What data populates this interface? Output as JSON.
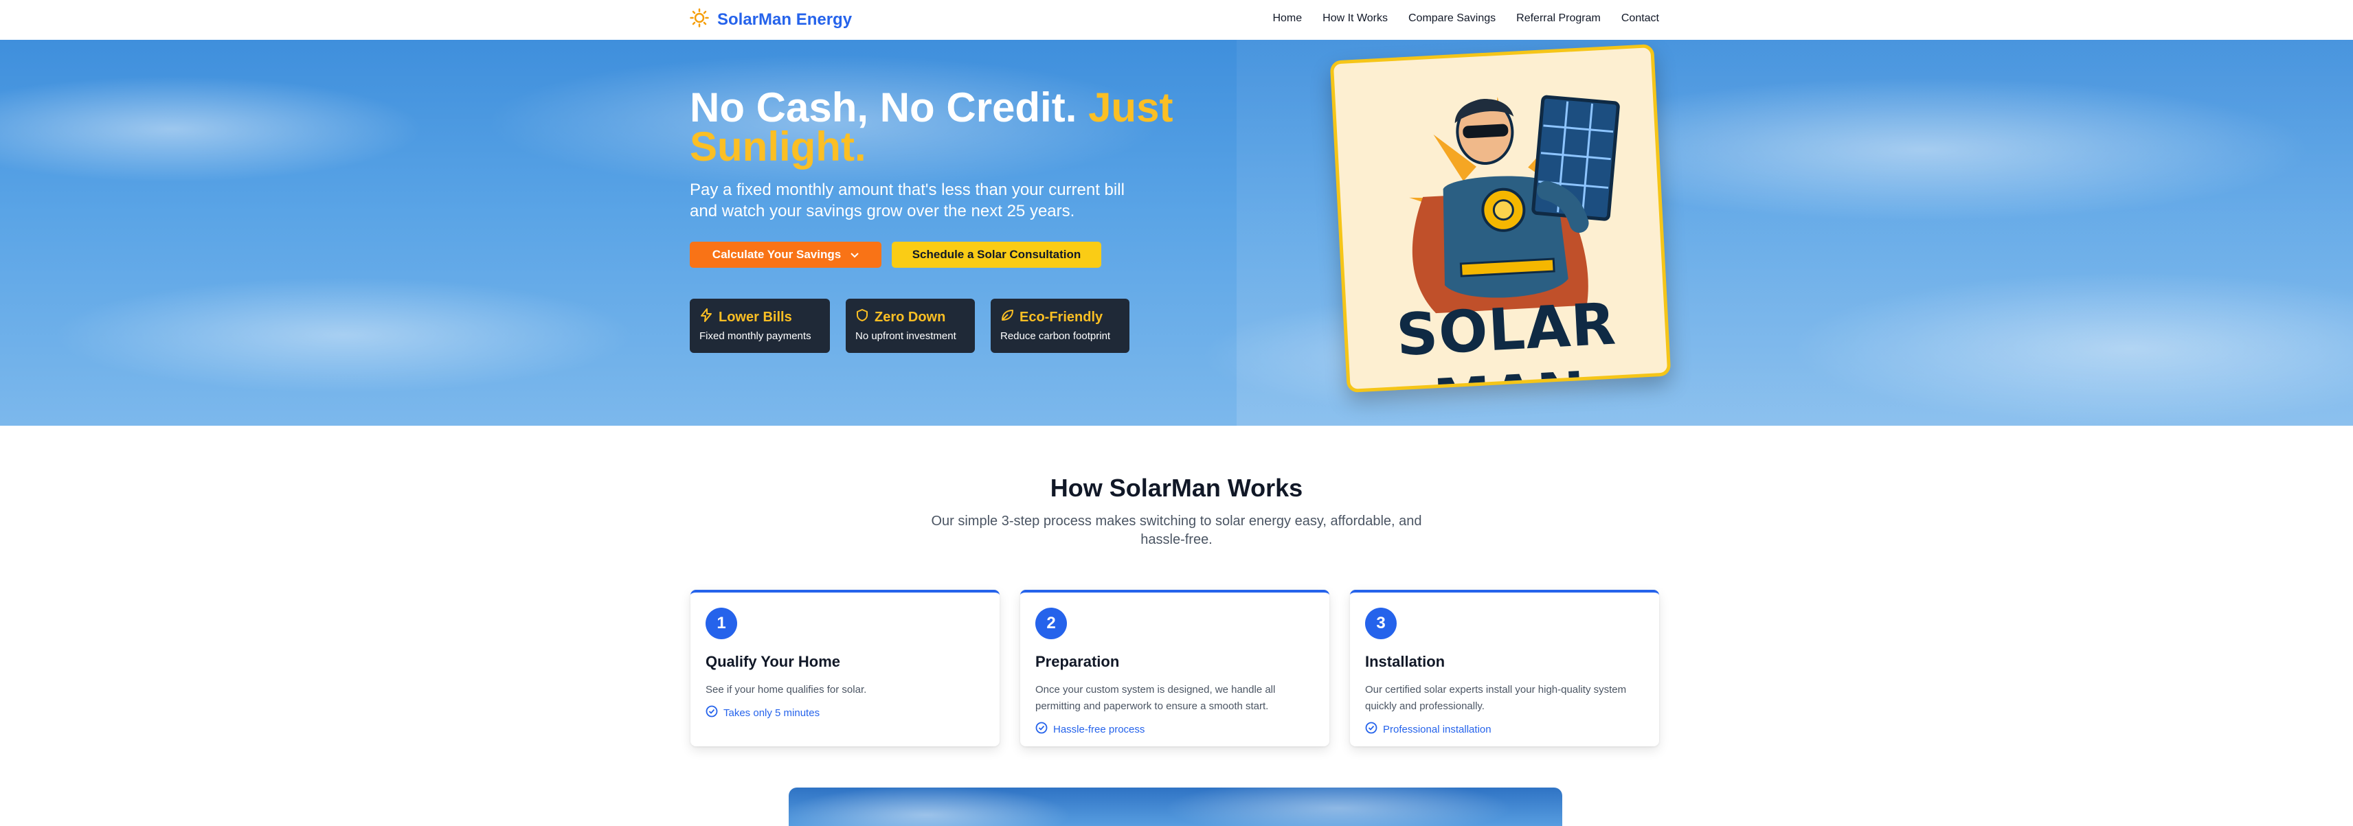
{
  "brand": {
    "name": "SolarMan Energy",
    "icon": "sun-icon"
  },
  "nav": {
    "links": [
      "Home",
      "How It Works",
      "Compare Savings",
      "Referral Program",
      "Contact"
    ]
  },
  "hero": {
    "title_main": "No Cash, No Credit.",
    "title_accent": "Just Sunlight.",
    "subtitle": "Pay a fixed monthly amount that's less than your current bill and watch your savings grow over the next 25 years.",
    "primary_button": "Calculate Your Savings",
    "secondary_button": "Schedule a Solar Consultation",
    "features": [
      {
        "icon": "lightning-icon",
        "title": "Lower Bills",
        "subtitle": "Fixed monthly payments"
      },
      {
        "icon": "shield-icon",
        "title": "Zero Down",
        "subtitle": "No upfront investment"
      },
      {
        "icon": "leaf-icon",
        "title": "Eco-Friendly",
        "subtitle": "Reduce carbon footprint"
      }
    ],
    "logo_text": "SOLAR MAN"
  },
  "how": {
    "title": "How SolarMan Works",
    "subtitle": "Our simple 3-step process makes switching to solar energy easy, affordable, and hassle-free.",
    "steps": [
      {
        "num": "1",
        "title": "Qualify Your Home",
        "desc": "See if your home qualifies for solar.",
        "note": "Takes only 5 minutes"
      },
      {
        "num": "2",
        "title": "Preparation",
        "desc": "Once your custom system is designed, we handle all permitting and paperwork to ensure a smooth start.",
        "note": "Hassle-free process"
      },
      {
        "num": "3",
        "title": "Installation",
        "desc": "Our certified solar experts install your high-quality system quickly and professionally.",
        "note": "Professional installation"
      }
    ]
  },
  "colors": {
    "brand_blue": "#2563eb",
    "accent_yellow": "#fbbf24",
    "orange": "#f97316",
    "dark": "#1f2937"
  }
}
